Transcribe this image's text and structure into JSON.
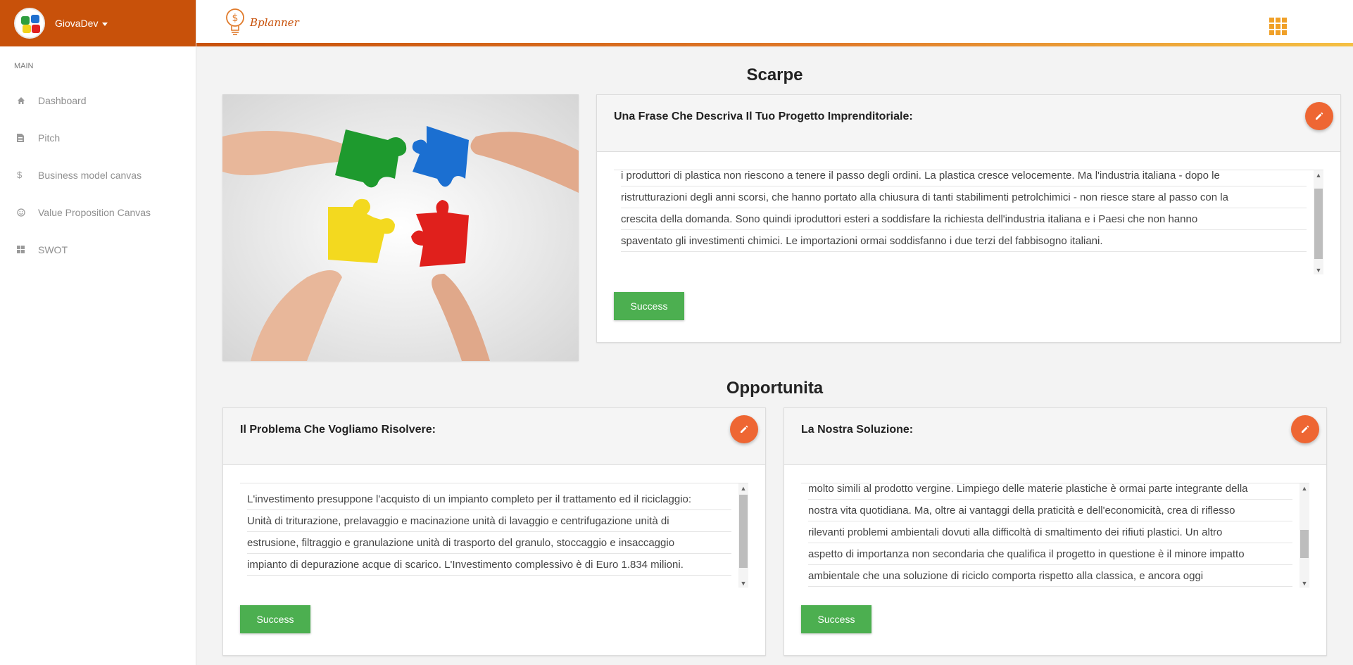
{
  "user": {
    "name": "GiovaDev"
  },
  "sidebar": {
    "section": "MAIN",
    "items": [
      {
        "label": "Dashboard",
        "icon": "home-icon"
      },
      {
        "label": "Pitch",
        "icon": "document-icon"
      },
      {
        "label": "Business model canvas",
        "icon": "dollar-icon"
      },
      {
        "label": "Value Proposition Canvas",
        "icon": "smiley-icon"
      },
      {
        "label": "SWOT",
        "icon": "grid-icon"
      }
    ]
  },
  "header": {
    "brand": "Bplanner"
  },
  "main": {
    "section1_title": "Scarpe",
    "section2_title": "Opportunita",
    "panels": [
      {
        "title": "Una Frase Che Descriva Il Tuo Progetto Imprenditoriale:",
        "lines": [
          "i produttori di plastica non riescono a tenere il passo degli ordini. La plastica cresce velocemente. Ma l'industria italiana - dopo le",
          "ristrutturazioni degli anni scorsi, che hanno portato alla chiusura di tanti stabilimenti petrolchimici - non riesce stare al passo con la",
          "crescita della domanda. Sono quindi iproduttori esteri a soddisfare la richiesta dell'industria italiana e i Paesi che non hanno",
          "spaventato gli investimenti chimici. Le importazioni ormai soddisfanno i due terzi del fabbisogno italiani."
        ],
        "button": "Success"
      },
      {
        "title": "Il Problema Che Vogliamo Risolvere:",
        "lines": [
          "L'investimento presuppone l'acquisto di un impianto completo per il trattamento ed il riciclaggio:",
          "Unità di triturazione, prelavaggio e macinazione unità di lavaggio e centrifugazione unità di",
          "estrusione, filtraggio e granulazione unità di trasporto del granulo, stoccaggio e insaccaggio",
          "impianto di depurazione acque di scarico. L'Investimento complessivo è di Euro 1.834 milioni."
        ],
        "button": "Success"
      },
      {
        "title": "La Nostra Soluzione:",
        "lines": [
          "molto simili al prodotto vergine. Limpiego delle materie plastiche è ormai parte integrante della",
          "nostra vita quotidiana. Ma, oltre ai vantaggi della praticità e dell'economicità, crea di riflesso",
          "rilevanti problemi ambientali dovuti alla difficoltà di smaltimento dei rifiuti plastici. Un altro",
          "aspetto di importanza non secondaria che qualifica il progetto in questione è il minore impatto",
          "ambientale che una soluzione di riciclo comporta rispetto alla classica, e ancora oggi"
        ],
        "button": "Success"
      }
    ]
  },
  "colors": {
    "brand": "#c8510a",
    "accent": "#ee6633",
    "success": "#4caf50",
    "apps": "#f0a028"
  }
}
